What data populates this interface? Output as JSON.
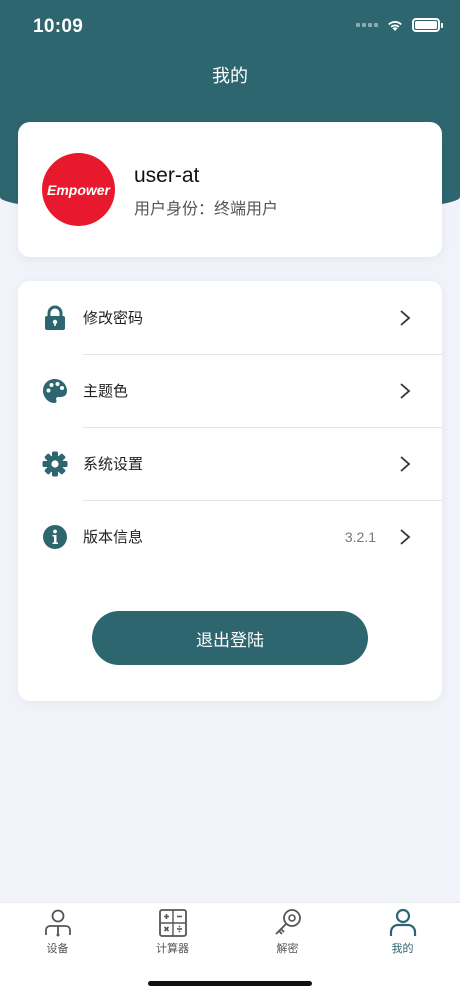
{
  "status_bar": {
    "time": "10:09"
  },
  "header": {
    "title": "我的"
  },
  "profile": {
    "avatar_text": "Empower",
    "username": "user-at",
    "role": "用户身份：终端用户"
  },
  "menu": {
    "items": [
      {
        "label": "修改密码",
        "icon": "lock-icon",
        "value": ""
      },
      {
        "label": "主题色",
        "icon": "palette-icon",
        "value": ""
      },
      {
        "label": "系统设置",
        "icon": "gear-icon",
        "value": ""
      },
      {
        "label": "版本信息",
        "icon": "info-icon",
        "value": "3.2.1"
      }
    ],
    "logout_label": "退出登陆"
  },
  "tabs": [
    {
      "label": "设备",
      "icon": "device-icon",
      "active": false
    },
    {
      "label": "计算器",
      "icon": "calculator-icon",
      "active": false
    },
    {
      "label": "解密",
      "icon": "key-icon",
      "active": false
    },
    {
      "label": "我的",
      "icon": "person-icon",
      "active": true
    }
  ],
  "colors": {
    "primary": "#2e6670",
    "brand_red": "#e8192c",
    "background": "#f1f3fb"
  }
}
